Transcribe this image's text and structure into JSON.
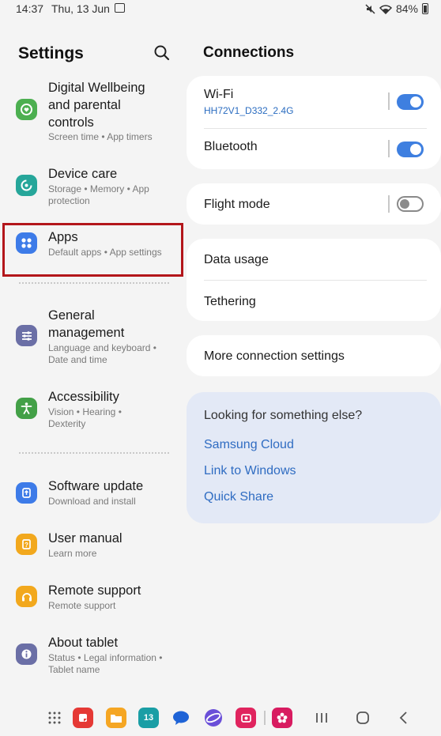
{
  "status_bar": {
    "time": "14:37",
    "date": "Thu, 13 Jun",
    "battery": "84%"
  },
  "settings": {
    "title": "Settings",
    "items": [
      {
        "title_lines": [
          "Digital Wellbeing",
          "and parental",
          "controls"
        ],
        "subtitle_lines": [
          "Screen time  •  App timers"
        ],
        "icon": "wellbeing-icon",
        "color": "#4caf50"
      },
      {
        "title_lines": [
          "Device care"
        ],
        "subtitle_lines": [
          "Storage  •  Memory  •  App",
          "protection"
        ],
        "icon": "device-care-icon",
        "color": "#26a69a"
      },
      {
        "title_lines": [
          "Apps"
        ],
        "subtitle_lines": [
          "Default apps  •  App settings"
        ],
        "icon": "apps-icon",
        "color": "#3d7be8"
      },
      {
        "title_lines": [
          "General",
          "management"
        ],
        "subtitle_lines": [
          "Language and keyboard  •",
          "Date and time"
        ],
        "icon": "general-management-icon",
        "color": "#6b6fa6"
      },
      {
        "title_lines": [
          "Accessibility"
        ],
        "subtitle_lines": [
          "Vision  •  Hearing  •",
          "Dexterity"
        ],
        "icon": "accessibility-icon",
        "color": "#43a047"
      },
      {
        "title_lines": [
          "Software update"
        ],
        "subtitle_lines": [
          "Download and install"
        ],
        "icon": "software-update-icon",
        "color": "#3d7be8"
      },
      {
        "title_lines": [
          "User manual"
        ],
        "subtitle_lines": [
          "Learn more"
        ],
        "icon": "user-manual-icon",
        "color": "#f2a81d"
      },
      {
        "title_lines": [
          "Remote support"
        ],
        "subtitle_lines": [
          "Remote support"
        ],
        "icon": "remote-support-icon",
        "color": "#f2a81d"
      },
      {
        "title_lines": [
          "About tablet"
        ],
        "subtitle_lines": [
          "Status  •  Legal information  •",
          "Tablet name"
        ],
        "icon": "about-tablet-icon",
        "color": "#6b6fa6"
      }
    ]
  },
  "connections": {
    "title": "Connections",
    "wifi": {
      "label": "Wi-Fi",
      "network": "HH72V1_D332_2.4G",
      "enabled": true
    },
    "bluetooth": {
      "label": "Bluetooth",
      "enabled": true
    },
    "flight_mode": {
      "label": "Flight mode",
      "enabled": false
    },
    "data_usage": {
      "label": "Data usage"
    },
    "tethering": {
      "label": "Tethering"
    },
    "more": {
      "label": "More connection settings"
    },
    "looking_for": {
      "question": "Looking for something else?",
      "links": [
        "Samsung Cloud",
        "Link to Windows",
        "Quick Share"
      ]
    }
  },
  "dock": {
    "apps": [
      {
        "icon": "app-drawer-icon",
        "color": "#555555"
      },
      {
        "icon": "notes-app-icon",
        "color": "#e53935"
      },
      {
        "icon": "my-files-icon",
        "color": "#f5a623"
      },
      {
        "icon": "calendar-icon",
        "color": "#1a9ea5",
        "label": "13"
      },
      {
        "icon": "messages-icon",
        "color": "#1e63d6"
      },
      {
        "icon": "internet-icon",
        "color": "#6a4fd8"
      },
      {
        "icon": "screen-recorder-icon",
        "color": "#e0245e"
      },
      {
        "icon": "gallery-icon",
        "color": "#d81b60"
      }
    ]
  }
}
